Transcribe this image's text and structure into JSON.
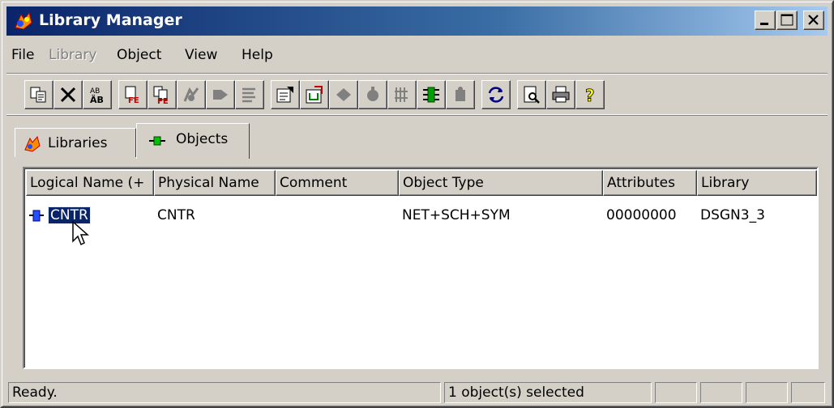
{
  "window": {
    "title": "Library Manager",
    "icon": "library-manager-icon"
  },
  "titlebar_buttons": [
    "minimize-icon",
    "maximize-icon",
    "close-icon"
  ],
  "menu": {
    "file": "File",
    "library": "Library",
    "object": "Object",
    "view": "View",
    "help": "Help"
  },
  "toolbar": {
    "buttons": [
      "copy-icon",
      "delete-icon",
      "rename-icon",
      "copy-fe-icon",
      "paste-fe-icon",
      "edit-icon",
      "run-icon",
      "list-icon",
      "properties-icon",
      "open-icon",
      "symbol-icon",
      "component-icon",
      "bus-icon",
      "pins-icon",
      "module-icon",
      "refresh-icon",
      "preview-icon",
      "print-icon",
      "help-icon"
    ]
  },
  "tabs": {
    "libraries": "Libraries",
    "objects": "Objects",
    "active": "Objects"
  },
  "list": {
    "columns": {
      "logical_name": "Logical Name (+",
      "physical_name": "Physical Name",
      "comment": "Comment",
      "object_type": "Object Type",
      "attributes": "Attributes",
      "library": "Library"
    },
    "rows": [
      {
        "logical_name": "CNTR",
        "physical_name": "CNTR",
        "comment": "",
        "object_type": "NET+SCH+SYM",
        "attributes": "00000000",
        "library": "DSGN3_3",
        "selected": true
      }
    ]
  },
  "status": {
    "message": "Ready.",
    "selection": "1 object(s) selected"
  },
  "colors": {
    "titlebar_start": "#0a246a",
    "titlebar_end": "#a6caf0",
    "face": "#d4d0c8",
    "selection": "#0a246a"
  }
}
